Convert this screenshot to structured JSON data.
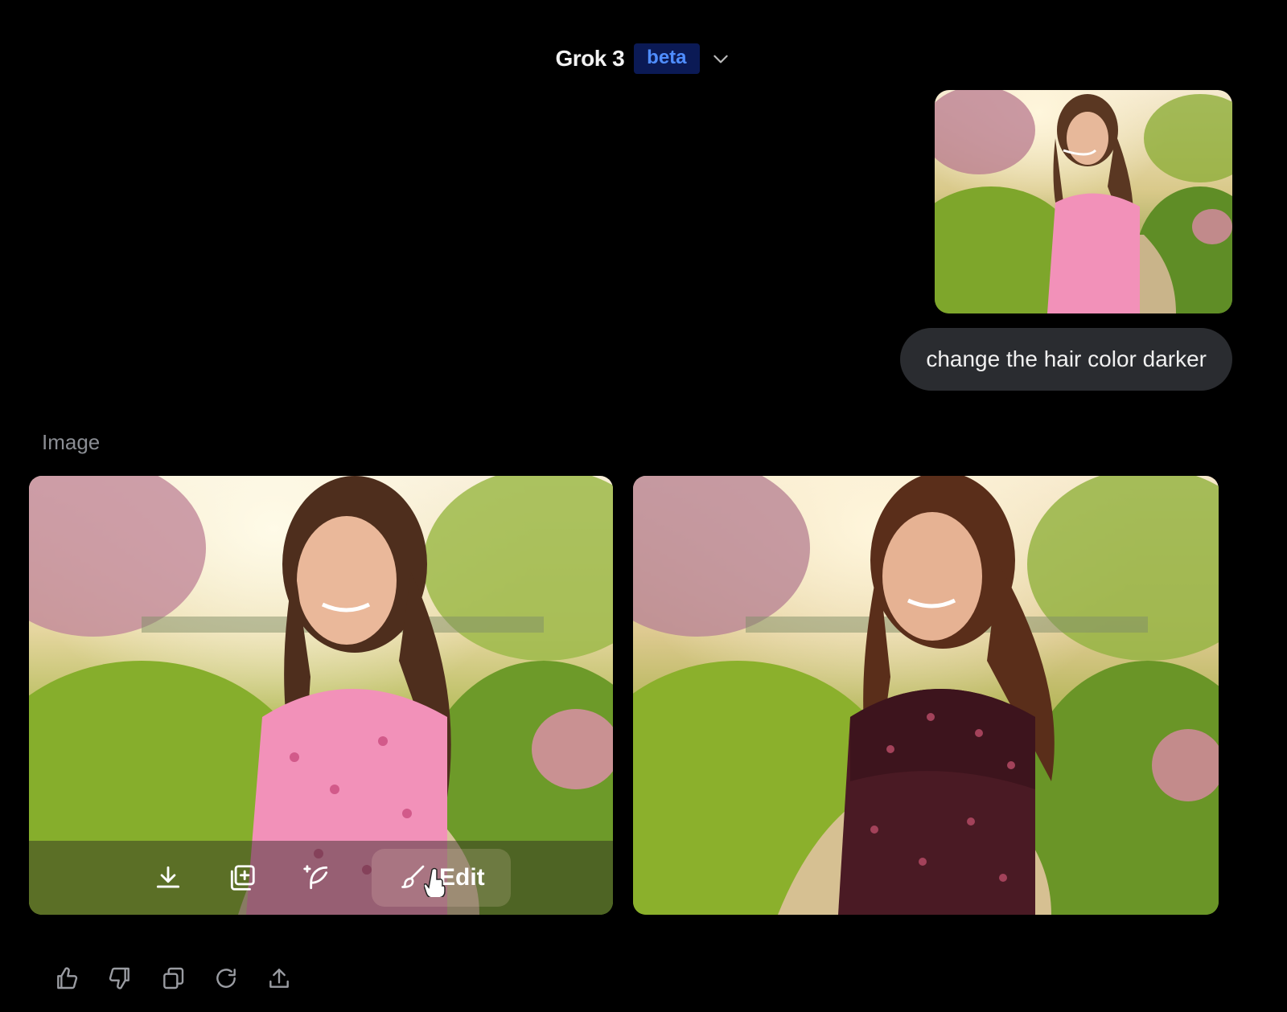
{
  "header": {
    "model_name": "Grok 3",
    "badge": "beta",
    "accent": "#4f8dff",
    "badge_bg": "#0b1a55"
  },
  "user_message": {
    "text": "change the hair color darker",
    "attachment": "uploaded-photo"
  },
  "assistant": {
    "section_label": "Image",
    "images": [
      {
        "name": "generated-image-1",
        "dress_color": "#f08fb6"
      },
      {
        "name": "generated-image-2",
        "dress_color": "#4a1a24"
      }
    ],
    "overlay": {
      "icons": [
        "download-icon",
        "add-to-collection-icon",
        "sparkle-feather-icon"
      ],
      "edit_label": "Edit",
      "edit_icon": "brush-icon"
    }
  },
  "actions": [
    "thumbs-up-icon",
    "thumbs-down-icon",
    "copy-icon",
    "regenerate-icon",
    "share-icon"
  ]
}
